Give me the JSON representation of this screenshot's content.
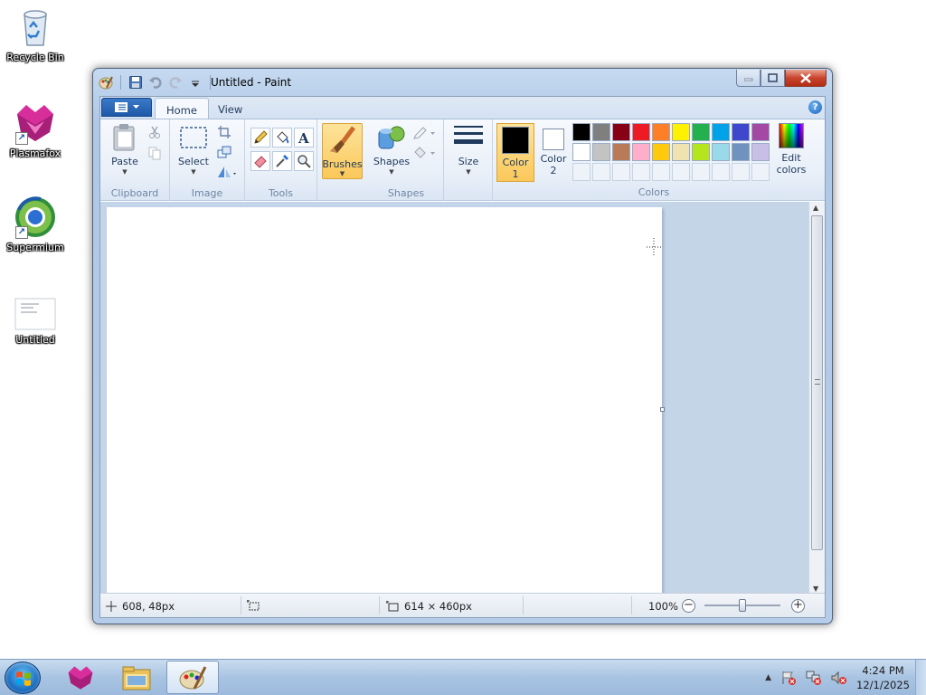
{
  "desktop": {
    "icons": [
      {
        "label": "Recycle Bin",
        "icon": "recycle-bin-icon"
      },
      {
        "label": "Plasmafox",
        "icon": "plasmafox-icon"
      },
      {
        "label": "Supermium",
        "icon": "supermium-icon"
      },
      {
        "label": "Untitled",
        "icon": "document-thumbnail-icon"
      }
    ]
  },
  "window": {
    "title": "Untitled - Paint",
    "tabs": [
      {
        "label": "Home",
        "active": true
      },
      {
        "label": "View",
        "active": false
      }
    ],
    "ribbon": {
      "clipboard": {
        "group_label": "Clipboard",
        "paste_label": "Paste"
      },
      "image": {
        "group_label": "Image",
        "select_label": "Select"
      },
      "tools": {
        "group_label": "Tools"
      },
      "brushes_label": "Brushes",
      "shapes": {
        "group_label": "Shapes",
        "shapes_label": "Shapes"
      },
      "size_label": "Size",
      "colors": {
        "group_label": "Colors",
        "color1_label": "Color 1",
        "color1_value": "#000000",
        "color2_label": "Color 2",
        "color2_value": "#ffffff",
        "edit_colors_label": "Edit colors",
        "palette_row1": [
          "#000000",
          "#7f7f7f",
          "#880015",
          "#ed1c24",
          "#ff7f27",
          "#fff200",
          "#22b14c",
          "#00a2e8",
          "#3f48cc",
          "#a349a4"
        ],
        "palette_row2": [
          "#ffffff",
          "#c3c3c3",
          "#b97a57",
          "#ffaec9",
          "#ffc90e",
          "#efe4b0",
          "#b5e61d",
          "#99d9ea",
          "#7092be",
          "#c8bfe7"
        ]
      }
    },
    "status": {
      "cursor_position": "608, 48px",
      "canvas_size": "614 × 460px",
      "zoom": "100%"
    }
  },
  "taskbar": {
    "clock_time": "4:24 PM",
    "clock_date": "12/1/2025"
  }
}
